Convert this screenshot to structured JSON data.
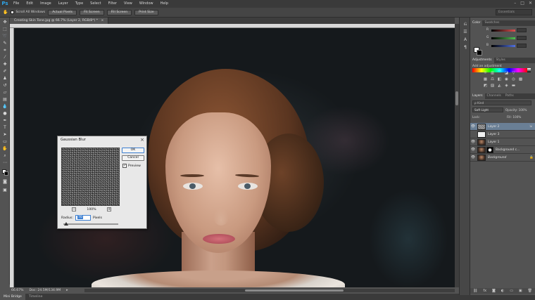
{
  "app": {
    "logo": "Ps",
    "menu": [
      "File",
      "Edit",
      "Image",
      "Layer",
      "Type",
      "Select",
      "Filter",
      "View",
      "Window",
      "Help"
    ],
    "window_controls": [
      "–",
      "□",
      "✕"
    ]
  },
  "options_bar": {
    "scroll_all_label": "Scroll All Windows",
    "buttons": [
      "Actual Pixels",
      "Fit Screen",
      "Fill Screen",
      "Print Size"
    ],
    "workspace": "Essentials"
  },
  "document": {
    "tab_title": "Creating Skin Tone.jpg @ 66.7% (Layer 2, RGB/8*) *",
    "tab_close": "×",
    "zoom": "66.67%",
    "doc_info": "Doc: 24.5M/134.9M"
  },
  "dialog": {
    "title": "Gaussian Blur",
    "close": "×",
    "ok_label": "OK",
    "cancel_label": "Cancel",
    "preview_label": "Preview",
    "preview_checked": "✓",
    "zoom_out": "−",
    "zoom_in": "+",
    "zoom_level": "100%",
    "radius_label": "Radius:",
    "radius_value": "70",
    "radius_unit": "Pixels"
  },
  "bottom_tabs": [
    "Mini Bridge",
    "Timeline"
  ],
  "panels": {
    "color_tabs": [
      "Color",
      "Swatches"
    ],
    "color_channels": [
      {
        "label": "R",
        "color": "#e05050"
      },
      {
        "label": "G",
        "color": "#50c050"
      },
      {
        "label": "B",
        "color": "#5070e0"
      }
    ],
    "adjustment_tabs": [
      "Adjustments",
      "Styles"
    ],
    "adjustments_title": "Add an adjustment",
    "layers_tabs": [
      "Layers",
      "Channels",
      "Paths"
    ],
    "layer_filter": "ρ Kind",
    "blend_mode": "Soft Light",
    "opacity_label": "Opacity:",
    "opacity_value": "100%",
    "lock_label": "Lock:",
    "fill_label": "Fill:",
    "fill_value": "100%",
    "layers": [
      {
        "name": "Layer 2",
        "selected": true
      },
      {
        "name": "Layer 3",
        "selected": false
      },
      {
        "name": "Layer 1",
        "selected": false
      },
      {
        "name": "Background c...",
        "selected": false
      },
      {
        "name": "Background",
        "selected": false
      }
    ]
  }
}
